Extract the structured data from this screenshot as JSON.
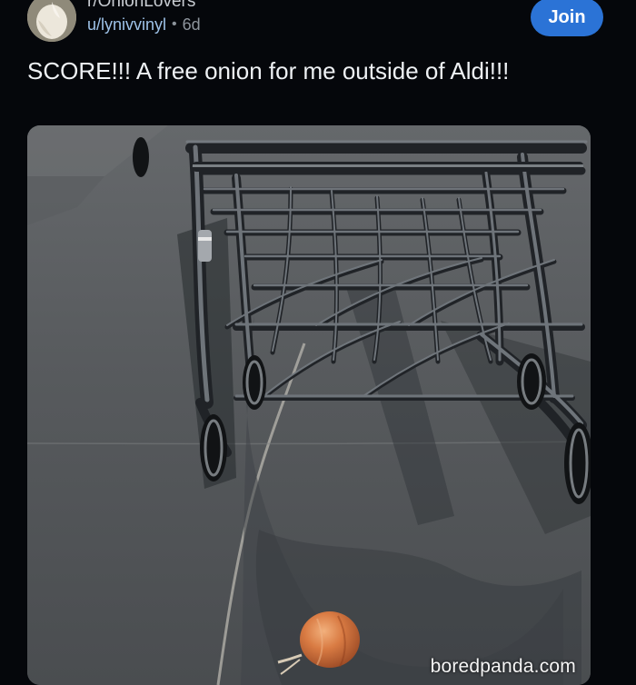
{
  "post": {
    "subreddit": "r/OnionLovers",
    "username": "u/lynivvinyl",
    "separator": "•",
    "age": "6d",
    "title": "SCORE!!! A free onion for me outside of Aldi!!!",
    "join_label": "Join"
  },
  "image": {
    "description_icon": "shopping-carts-photo",
    "watermark": "boredpanda.com"
  },
  "colors": {
    "background": "#05070b",
    "join_button": "#2b73d6",
    "username": "#9ec2e8",
    "meta_text": "#8d949c"
  }
}
